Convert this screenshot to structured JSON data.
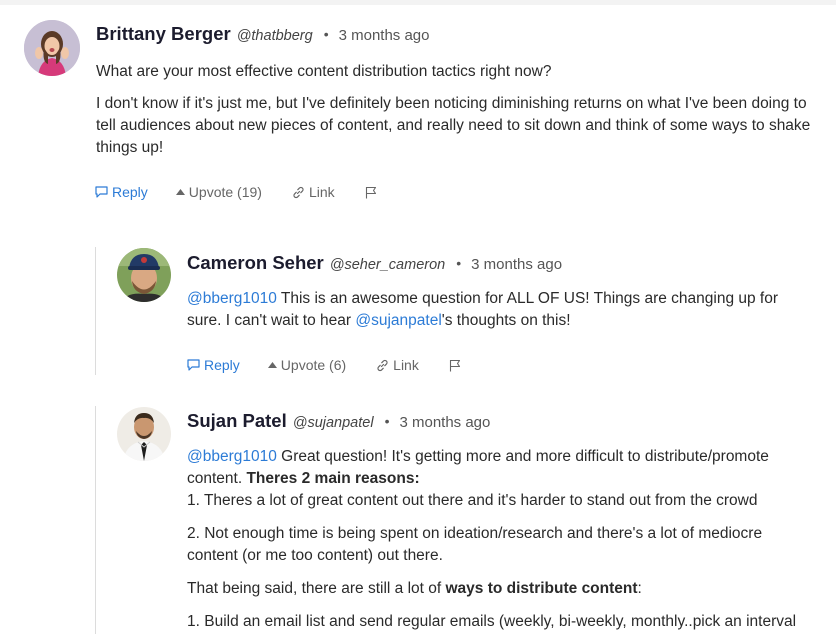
{
  "comments": [
    {
      "author": "Brittany Berger",
      "handle": "@thatbberg",
      "separator": "•",
      "time": "3 months ago",
      "paragraphs": [
        "What are your most effective content distribution tactics right now?",
        "I don't know if it's just me, but I've definitely been noticing diminishing returns on what I've been doing to tell audiences about new pieces of content, and really need to sit down and think of some ways to shake things up!"
      ],
      "actions": {
        "reply": "Reply",
        "upvote": "Upvote (19)",
        "link": "Link"
      }
    },
    {
      "author": "Cameron Seher",
      "handle": "@seher_cameron",
      "separator": "•",
      "time": "3 months ago",
      "body": {
        "mention1": "@bberg1010",
        "text1": " This is an awesome question for ALL OF US! Things are changing up for sure. I can't wait to hear ",
        "mention2": "@sujanpatel",
        "text2": "'s thoughts on this!"
      },
      "actions": {
        "reply": "Reply",
        "upvote": "Upvote (6)",
        "link": "Link"
      }
    },
    {
      "author": "Sujan Patel",
      "handle": "@sujanpatel",
      "separator": "•",
      "time": "3 months ago",
      "body": {
        "mention": "@bberg1010",
        "intro": " Great question! It's getting more and more difficult to distribute/promote content. ",
        "bold_reasons": "Theres 2 main reasons:",
        "reason1": "1. Theres a lot of great content out there and it's harder to stand out from the crowd",
        "reason2": "2. Not enough time is being spent on ideation/research and there's a lot of mediocre content (or me too content) out there.",
        "that_being_said": "That being said, there are still a lot of ",
        "bold_ways": "ways to distribute content",
        "colon": ":",
        "item1": "1. Build an email list and send regular emails (weekly, bi-weekly, monthly..pick an interval"
      }
    }
  ],
  "colors": {
    "mention": "#2c7bd6",
    "reply": "#2c7bd6"
  },
  "icons": [
    "speech-bubble-icon",
    "caret-up-icon",
    "chain-link-icon",
    "flag-icon"
  ]
}
